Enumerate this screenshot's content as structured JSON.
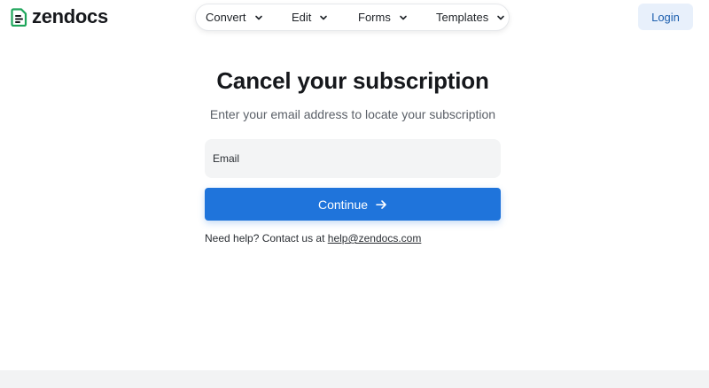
{
  "header": {
    "logo_text": "zendocs",
    "nav": [
      {
        "label": "Convert",
        "icon": "chevron-down-icon"
      },
      {
        "label": "Edit",
        "icon": "chevron-down-icon"
      },
      {
        "label": "Forms",
        "icon": "chevron-down-icon"
      },
      {
        "label": "Templates",
        "icon": "chevron-down-icon"
      }
    ],
    "login_label": "Login"
  },
  "main": {
    "title": "Cancel your subscription",
    "subtitle": "Enter your email address to locate your subscription",
    "email_placeholder": "Email",
    "continue_label": "Continue",
    "help_text": "Need help? Contact us at",
    "help_email": "help@zendocs.com"
  },
  "colors": {
    "brand_green": "#1ea55a",
    "primary_blue": "#1f74db",
    "login_bg": "#e8f0fb",
    "login_text": "#1d5fae"
  }
}
